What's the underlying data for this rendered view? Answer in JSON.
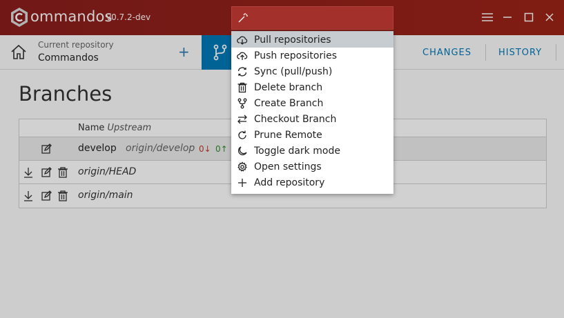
{
  "app": {
    "name": "ommandos",
    "version": "v0.7.2-dev",
    "brand_color": "#8b1d1d",
    "accent_color": "#0079b8"
  },
  "palette": {
    "placeholder": "",
    "value": "",
    "items": [
      {
        "label": "Pull repositories",
        "icon": "cloud-download-icon",
        "active": true
      },
      {
        "label": "Push repositories",
        "icon": "cloud-upload-icon"
      },
      {
        "label": "Sync (pull/push)",
        "icon": "sync-icon"
      },
      {
        "label": "Delete branch",
        "icon": "trash-icon"
      },
      {
        "label": "Create Branch",
        "icon": "branch-icon"
      },
      {
        "label": "Checkout Branch",
        "icon": "swap-icon"
      },
      {
        "label": "Prune Remote",
        "icon": "refresh-icon"
      },
      {
        "label": "Toggle dark mode",
        "icon": "moon-icon"
      },
      {
        "label": "Open settings",
        "icon": "gear-icon"
      },
      {
        "label": "Add repository",
        "icon": "plus-icon"
      }
    ]
  },
  "toolbar": {
    "repo_label": "Current repository",
    "repo_name": "Commandos",
    "add_symbol": "+",
    "tabs": [
      {
        "label": "CHANGES"
      },
      {
        "label": "HISTORY"
      }
    ]
  },
  "main": {
    "title": "Branches",
    "table": {
      "header_name": "Name",
      "header_upstream": "Upstream",
      "rows": [
        {
          "name": "develop",
          "upstream": "origin/develop",
          "behind": "0",
          "ahead": "0",
          "remote": false
        },
        {
          "name": "origin/HEAD",
          "remote": true
        },
        {
          "name": "origin/main",
          "remote": true
        }
      ]
    }
  }
}
